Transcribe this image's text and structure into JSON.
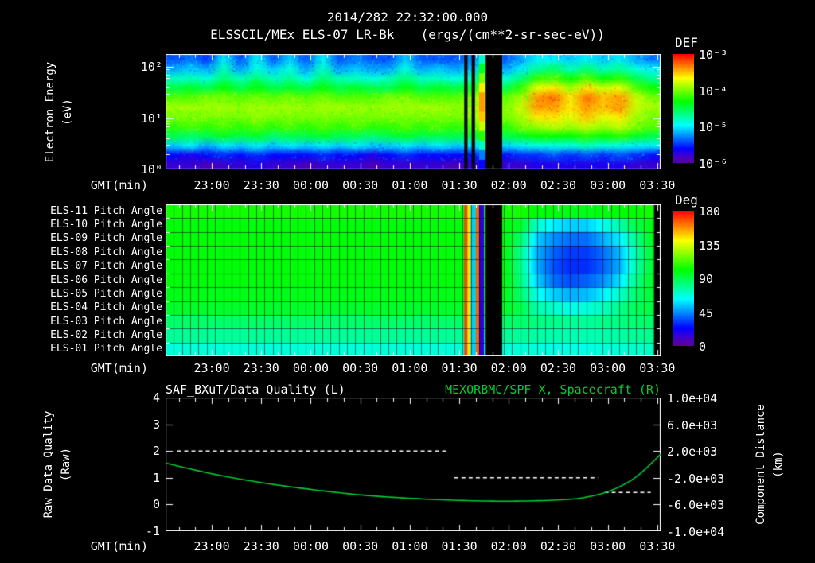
{
  "header": {
    "datetime": "2014/282 22:32:00.000",
    "title": "ELSSCIL/MEx ELS-07 LR-Bk",
    "units": "(ergs/(cm**2-sr-sec-eV))"
  },
  "colors": {
    "background": "#000000",
    "text": "#ffffff",
    "series_green": "#00cc33",
    "dashed_white": "#ffffff"
  },
  "time_axis": {
    "label": "GMT(min)",
    "span_minutes": 300,
    "tick_labels": [
      "23:00",
      "23:30",
      "00:00",
      "00:30",
      "01:00",
      "01:30",
      "02:00",
      "02:30",
      "03:00",
      "03:30"
    ],
    "tick_minutes": [
      28,
      58,
      88,
      118,
      148,
      178,
      208,
      238,
      268,
      298
    ]
  },
  "chart_data": [
    {
      "type": "heatmap",
      "name": "electron-energy-spectrogram",
      "ylabel_line1": "Electron Energy",
      "ylabel_line2": "(eV)",
      "y_scale": "log",
      "y_tick_labels": [
        "10²",
        "10¹",
        "10⁰"
      ],
      "y_tick_exponents": [
        2,
        1,
        0
      ],
      "ylim_ev": [
        1,
        178
      ],
      "colorbar": {
        "label": "DEF",
        "tick_labels": [
          "10⁻³",
          "10⁻⁴",
          "10⁻⁵",
          "10⁻⁶"
        ],
        "log10_range": [
          -6,
          -3
        ]
      },
      "grid": {
        "time_bin_minutes": 10,
        "energy_rows_top_to_bottom_ev": [
          170,
          110,
          70,
          45,
          28,
          18,
          11,
          7,
          4.5,
          2.9,
          1.8,
          1.2
        ],
        "columns": [
          [
            -5.4,
            -5.2,
            -4.8,
            -4.5,
            -4.1,
            -3.9,
            -4.0,
            -4.2,
            -4.5,
            -5.1,
            -5.6,
            -5.8
          ],
          [
            -5.3,
            -5.1,
            -4.8,
            -4.4,
            -4.1,
            -3.9,
            -4.0,
            -4.1,
            -4.6,
            -5.0,
            -5.7,
            -5.8
          ],
          [
            -5.5,
            -5.2,
            -4.9,
            -4.5,
            -4.0,
            -3.9,
            -4.0,
            -4.2,
            -4.5,
            -5.2,
            -5.6,
            -5.9
          ],
          [
            -5.0,
            -4.8,
            -4.6,
            -4.3,
            -4.0,
            -3.9,
            -4.0,
            -4.1,
            -4.4,
            -5.0,
            -5.5,
            -5.8
          ],
          [
            -5.4,
            -5.2,
            -4.8,
            -4.5,
            -4.1,
            -3.95,
            -4.0,
            -4.2,
            -4.5,
            -5.1,
            -5.6,
            -5.8
          ],
          [
            -5.0,
            -4.9,
            -4.6,
            -4.3,
            -4.0,
            -3.9,
            -3.95,
            -4.1,
            -4.4,
            -5.0,
            -5.5,
            -5.7
          ],
          [
            -5.4,
            -5.1,
            -4.8,
            -4.5,
            -4.1,
            -3.9,
            -4.0,
            -4.2,
            -4.6,
            -5.1,
            -5.6,
            -5.8
          ],
          [
            -5.1,
            -4.9,
            -4.7,
            -4.4,
            -4.0,
            -3.9,
            -4.0,
            -4.1,
            -4.5,
            -5.0,
            -5.6,
            -5.8
          ],
          [
            -5.4,
            -5.2,
            -4.9,
            -4.5,
            -4.1,
            -3.95,
            -4.0,
            -4.2,
            -4.5,
            -5.1,
            -5.6,
            -5.9
          ],
          [
            -5.0,
            -4.8,
            -4.6,
            -4.3,
            -4.0,
            -3.9,
            -4.0,
            -4.1,
            -4.4,
            -5.0,
            -5.5,
            -5.8
          ],
          [
            -5.4,
            -5.2,
            -4.8,
            -4.5,
            -4.1,
            -3.9,
            -4.0,
            -4.2,
            -4.5,
            -5.1,
            -5.6,
            -5.8
          ],
          [
            -5.3,
            -5.1,
            -4.8,
            -4.4,
            -4.1,
            -3.9,
            -4.0,
            -4.1,
            -4.5,
            -5.0,
            -5.6,
            -5.8
          ],
          [
            -5.4,
            -5.2,
            -4.9,
            -4.5,
            -4.1,
            -3.95,
            -4.0,
            -4.2,
            -4.6,
            -5.1,
            -5.7,
            -5.9
          ],
          [
            -5.4,
            -5.2,
            -4.8,
            -4.5,
            -4.0,
            -3.9,
            -4.0,
            -4.2,
            -4.5,
            -5.1,
            -5.6,
            -5.8
          ],
          [
            -5.1,
            -4.9,
            -4.6,
            -4.3,
            -4.0,
            -3.9,
            -4.0,
            -4.1,
            -4.4,
            -5.0,
            -5.5,
            -5.8
          ],
          [
            -5.4,
            -5.2,
            -4.8,
            -4.5,
            -4.1,
            -3.9,
            -4.0,
            -4.2,
            -4.5,
            -5.1,
            -5.6,
            -5.8
          ],
          [
            -5.4,
            -5.1,
            -4.8,
            -4.4,
            -4.1,
            -3.9,
            -4.0,
            -4.1,
            -4.5,
            -5.0,
            -5.6,
            -5.8
          ],
          [
            -5.4,
            -5.2,
            -4.9,
            -4.5,
            -4.1,
            -3.95,
            -4.0,
            -4.2,
            -4.5,
            -5.1,
            -5.6,
            -5.9
          ],
          [
            -5.3,
            -5.1,
            -4.8,
            -4.4,
            -4.0,
            -3.9,
            -3.95,
            -4.1,
            -4.5,
            -5.0,
            -5.6,
            -5.8
          ],
          [
            -5.0,
            -4.7,
            -4.3,
            -3.9,
            -3.7,
            -3.6,
            -3.7,
            -3.9,
            -4.3,
            -4.9,
            -5.4,
            -5.7
          ],
          [
            -5.4,
            -5.2,
            -4.9,
            -4.5,
            -4.1,
            -4.0,
            -4.0,
            -4.2,
            -4.5,
            -5.1,
            -5.6,
            -5.8
          ],
          [
            -5.2,
            -5.0,
            -4.6,
            -4.2,
            -3.9,
            -3.8,
            -3.9,
            -4.0,
            -4.4,
            -5.0,
            -5.5,
            -5.8
          ],
          [
            -5.0,
            -4.7,
            -4.2,
            -3.7,
            -3.4,
            -3.4,
            -3.6,
            -3.9,
            -4.3,
            -4.9,
            -5.5,
            -5.7
          ],
          [
            -5.0,
            -4.6,
            -4.1,
            -3.6,
            -3.3,
            -3.4,
            -3.6,
            -3.8,
            -4.3,
            -4.9,
            -5.4,
            -5.7
          ],
          [
            -5.1,
            -4.8,
            -4.3,
            -3.9,
            -3.6,
            -3.6,
            -3.7,
            -3.9,
            -4.3,
            -4.9,
            -5.5,
            -5.7
          ],
          [
            -5.0,
            -4.6,
            -4.1,
            -3.6,
            -3.3,
            -3.4,
            -3.5,
            -3.8,
            -4.2,
            -4.8,
            -5.4,
            -5.7
          ],
          [
            -5.1,
            -4.8,
            -4.3,
            -3.8,
            -3.5,
            -3.5,
            -3.7,
            -3.9,
            -4.3,
            -4.9,
            -5.5,
            -5.7
          ],
          [
            -5.0,
            -4.7,
            -4.2,
            -3.7,
            -3.4,
            -3.4,
            -3.6,
            -3.8,
            -4.2,
            -4.9,
            -5.4,
            -5.7
          ],
          [
            -5.2,
            -4.9,
            -4.5,
            -4.1,
            -3.8,
            -3.8,
            -3.9,
            -4.0,
            -4.4,
            -5.0,
            -5.5,
            -5.8
          ],
          [
            -5.3,
            -5.0,
            -4.7,
            -4.3,
            -4.0,
            -3.9,
            -4.0,
            -4.1,
            -4.5,
            -5.0,
            -5.6,
            -5.8
          ]
        ]
      },
      "bright_columns": [
        {
          "t0": 190,
          "t1": 193.5,
          "log10_flux_rows": [
            -4.8,
            -4.4,
            -4.0,
            -3.6,
            -3.4,
            -3.4,
            -3.5,
            -3.8,
            -4.2,
            -4.8,
            -5.3,
            -5.6
          ]
        }
      ],
      "gaps": [
        {
          "t0": 181,
          "t1": 183
        },
        {
          "t0": 185.5,
          "t1": 187.5
        },
        {
          "t0": 194,
          "t1": 204
        }
      ]
    },
    {
      "type": "heatmap",
      "name": "pitch-angle-panel",
      "rows": [
        "ELS-11 Pitch Angle",
        "ELS-10 Pitch Angle",
        "ELS-09 Pitch Angle",
        "ELS-08 Pitch Angle",
        "ELS-07 Pitch Angle",
        "ELS-06 Pitch Angle",
        "ELS-05 Pitch Angle",
        "ELS-04 Pitch Angle",
        "ELS-03 Pitch Angle",
        "ELS-02 Pitch Angle",
        "ELS-01 Pitch Angle"
      ],
      "colorbar": {
        "label": "Deg",
        "tick_labels": [
          "180",
          "135",
          "90",
          "45",
          "0"
        ],
        "range": [
          0,
          180
        ]
      },
      "grid_degrees": [
        [
          104,
          100,
          100,
          100,
          100,
          100,
          98,
          95,
          85,
          78,
          68
        ],
        [
          104,
          100,
          100,
          100,
          100,
          100,
          98,
          95,
          85,
          78,
          68
        ],
        [
          104,
          100,
          100,
          100,
          100,
          100,
          98,
          95,
          85,
          78,
          68
        ],
        [
          104,
          100,
          100,
          100,
          100,
          100,
          98,
          95,
          85,
          78,
          68
        ],
        [
          104,
          100,
          100,
          100,
          100,
          100,
          98,
          95,
          85,
          78,
          68
        ],
        [
          104,
          100,
          100,
          100,
          100,
          100,
          98,
          95,
          85,
          78,
          68
        ],
        [
          104,
          100,
          100,
          100,
          100,
          100,
          98,
          95,
          85,
          78,
          68
        ],
        [
          104,
          100,
          100,
          100,
          100,
          100,
          98,
          95,
          85,
          78,
          68
        ],
        [
          104,
          100,
          100,
          100,
          100,
          100,
          98,
          95,
          85,
          78,
          68
        ],
        [
          104,
          100,
          100,
          100,
          100,
          100,
          98,
          95,
          85,
          78,
          68
        ],
        [
          104,
          100,
          100,
          100,
          100,
          100,
          98,
          95,
          85,
          78,
          68
        ],
        [
          104,
          100,
          100,
          100,
          100,
          100,
          98,
          95,
          85,
          78,
          68
        ],
        [
          104,
          100,
          100,
          100,
          100,
          100,
          98,
          95,
          85,
          78,
          68
        ],
        [
          104,
          100,
          100,
          100,
          100,
          100,
          98,
          95,
          85,
          78,
          68
        ],
        [
          104,
          100,
          100,
          100,
          100,
          100,
          98,
          95,
          85,
          78,
          68
        ],
        [
          104,
          100,
          100,
          100,
          100,
          100,
          98,
          95,
          85,
          78,
          68
        ],
        [
          104,
          100,
          100,
          100,
          100,
          100,
          98,
          95,
          85,
          78,
          68
        ],
        [
          104,
          100,
          100,
          100,
          100,
          100,
          98,
          95,
          85,
          78,
          68
        ],
        [
          104,
          100,
          100,
          100,
          100,
          100,
          98,
          95,
          85,
          78,
          68
        ],
        [
          104,
          100,
          100,
          100,
          100,
          100,
          98,
          95,
          85,
          78,
          68
        ],
        [
          104,
          100,
          100,
          100,
          100,
          100,
          98,
          95,
          85,
          78,
          68
        ],
        [
          105,
          95,
          85,
          80,
          80,
          82,
          85,
          90,
          85,
          78,
          68
        ],
        [
          100,
          70,
          55,
          50,
          50,
          55,
          65,
          75,
          82,
          76,
          68
        ],
        [
          100,
          60,
          45,
          38,
          35,
          40,
          55,
          70,
          80,
          75,
          66
        ],
        [
          98,
          55,
          40,
          32,
          30,
          35,
          50,
          65,
          78,
          74,
          66
        ],
        [
          98,
          55,
          40,
          32,
          30,
          38,
          52,
          68,
          78,
          74,
          66
        ],
        [
          100,
          65,
          50,
          40,
          38,
          45,
          60,
          72,
          80,
          75,
          68
        ],
        [
          100,
          75,
          60,
          52,
          50,
          58,
          70,
          80,
          82,
          76,
          68
        ],
        [
          102,
          90,
          80,
          75,
          75,
          80,
          85,
          88,
          84,
          78,
          70
        ],
        [
          105,
          100,
          98,
          95,
          95,
          96,
          95,
          92,
          86,
          80,
          72
        ]
      ],
      "stripes": [
        {
          "t0": 181,
          "t1": 183,
          "deg": 170
        },
        {
          "t0": 183,
          "t1": 185,
          "deg": 145
        },
        {
          "t0": 185,
          "t1": 188,
          "deg": 55
        },
        {
          "t0": 188,
          "t1": 190,
          "deg": 165
        },
        {
          "t0": 190,
          "t1": 193,
          "deg": 15
        }
      ],
      "gaps": [
        {
          "t0": 194,
          "t1": 204
        },
        {
          "t0": 296,
          "t1": 300
        }
      ]
    },
    {
      "type": "line",
      "name": "quality-and-distance",
      "title_left": "SAF_BXuT/Data Quality (L)",
      "title_right": "MEXORBMC/SPF X, Spacecraft (R)",
      "ylabel_left_line1": "Raw Data Quality",
      "ylabel_left_line2": "(Raw)",
      "ylabel_right_line1": "Component Distance",
      "ylabel_right_line2": "(km)",
      "ylim_left": [
        -1,
        4
      ],
      "ytick_labels_left": [
        "4",
        "3",
        "2",
        "1",
        "0",
        "-1"
      ],
      "ytick_values_left": [
        4,
        3,
        2,
        1,
        0,
        -1
      ],
      "ylim_right": [
        -10000,
        10000
      ],
      "ytick_labels_right": [
        "1.0e+04",
        "6.0e+03",
        "2.0e+03",
        "-2.0e+03",
        "-6.0e+03",
        "-1.0e+04"
      ],
      "ytick_values_right": [
        10000,
        6000,
        2000,
        -2000,
        -6000,
        -10000
      ],
      "series": [
        {
          "name": "SAF_BXuT/Data Quality",
          "axis": "left",
          "style": "dashed",
          "segments": [
            {
              "value": 2,
              "t0": 7,
              "t1": 170
            },
            {
              "value": 1,
              "t0": 175,
              "t1": 262
            },
            {
              "value": 0.45,
              "t0": 266,
              "t1": 294
            }
          ]
        },
        {
          "name": "MEXORBMC/SPF X Spacecraft",
          "axis": "right",
          "style": "solid",
          "points_t_min": [
            0,
            30,
            60,
            90,
            120,
            150,
            180,
            210,
            240,
            255,
            270,
            285,
            300
          ],
          "points_km": [
            200,
            -1500,
            -2800,
            -3800,
            -4600,
            -5100,
            -5400,
            -5500,
            -5300,
            -4900,
            -3900,
            -1900,
            1500
          ]
        }
      ]
    }
  ]
}
